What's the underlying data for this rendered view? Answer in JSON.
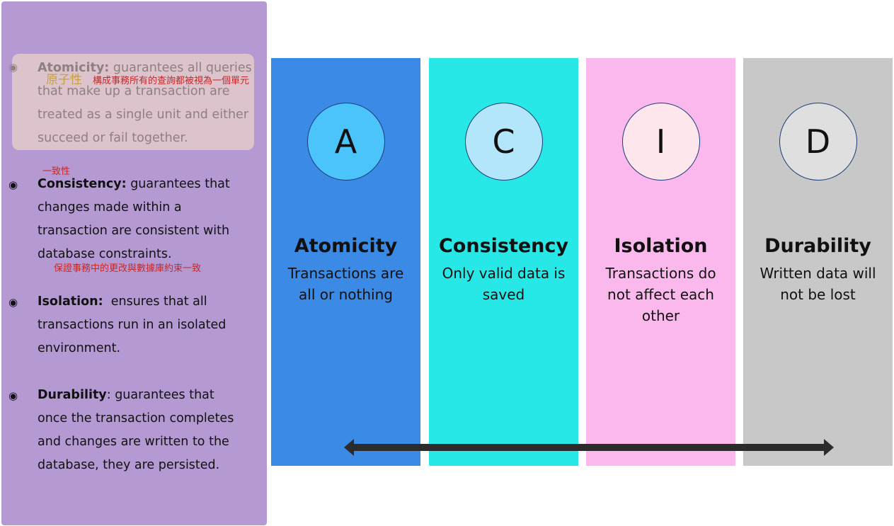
{
  "properties": [
    {
      "term": "Atomicity:",
      "text": " guarantees all queries that make up a transaction are treated as a single unit and either succeed or fail together.",
      "annotation_term": "原子性",
      "annotation_text": "構成事務所有的查詢都被視為一個單元"
    },
    {
      "term": "Consistency:",
      "text": " guarantees that changes made within a transaction are consistent with database constraints.",
      "annotation_term": "一致性",
      "annotation_text": "保證事務中的更改與數據庫約束一致"
    },
    {
      "term": "Isolation:",
      "text": "  ensures that all transactions run in an isolated environment."
    },
    {
      "term": "Durability",
      "text": ": guarantees that once the transaction completes and changes are written to the database, they are persisted."
    }
  ],
  "columns": [
    {
      "letter": "A",
      "title": "Atomicity",
      "desc": "Transactions are all or nothing",
      "bg": "#3a8ae6",
      "circle": "#4bc4fb"
    },
    {
      "letter": "C",
      "title": "Consistency",
      "desc": "Only valid data is saved",
      "bg": "#27e8e6",
      "circle": "#b3e6fb"
    },
    {
      "letter": "I",
      "title": "Isolation",
      "desc": "Transactions do not affect each other",
      "bg": "#fbb8ec",
      "circle": "#fde7ec"
    },
    {
      "letter": "D",
      "title": "Durability",
      "desc": "Written data will not be lost",
      "bg": "#c8c8c8",
      "circle": "#dfdfdf"
    }
  ],
  "colors": {
    "panel": "#b499d3",
    "highlight": "#ddc3cc",
    "arrow": "#2b2b2b",
    "annotation": "#c62828"
  }
}
